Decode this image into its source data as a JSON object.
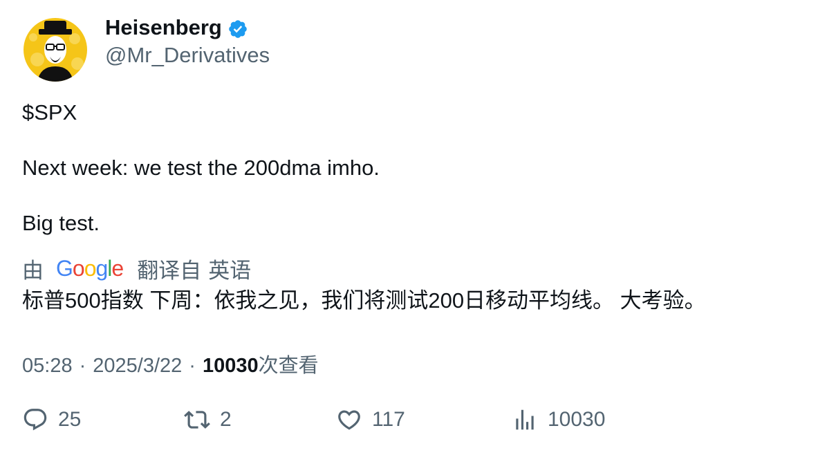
{
  "author": {
    "display_name": "Heisenberg",
    "handle": "@Mr_Derivatives",
    "verified_icon": "verified-badge-icon",
    "avatar_icon": "heisenberg-avatar"
  },
  "tweet": {
    "paragraphs": [
      "$SPX",
      "Next week: we test the 200dma imho.",
      "Big test."
    ]
  },
  "translation": {
    "by_label": "由",
    "provider": "Google",
    "from_label": "翻译自",
    "language": "英语",
    "text": "标普500指数 下周：依我之见，我们将测试200日移动平均线。 大考验。"
  },
  "meta": {
    "time": "05:28",
    "separator": "·",
    "date": "2025/3/22",
    "views_count": "10030",
    "views_label": "次查看"
  },
  "actions": {
    "replies": "25",
    "reposts": "2",
    "likes": "117",
    "views": "10030"
  },
  "colors": {
    "text_primary": "#0f1419",
    "text_secondary": "#536471",
    "verified_blue": "#1d9bf0",
    "avatar_yellow": "#f5c518"
  }
}
